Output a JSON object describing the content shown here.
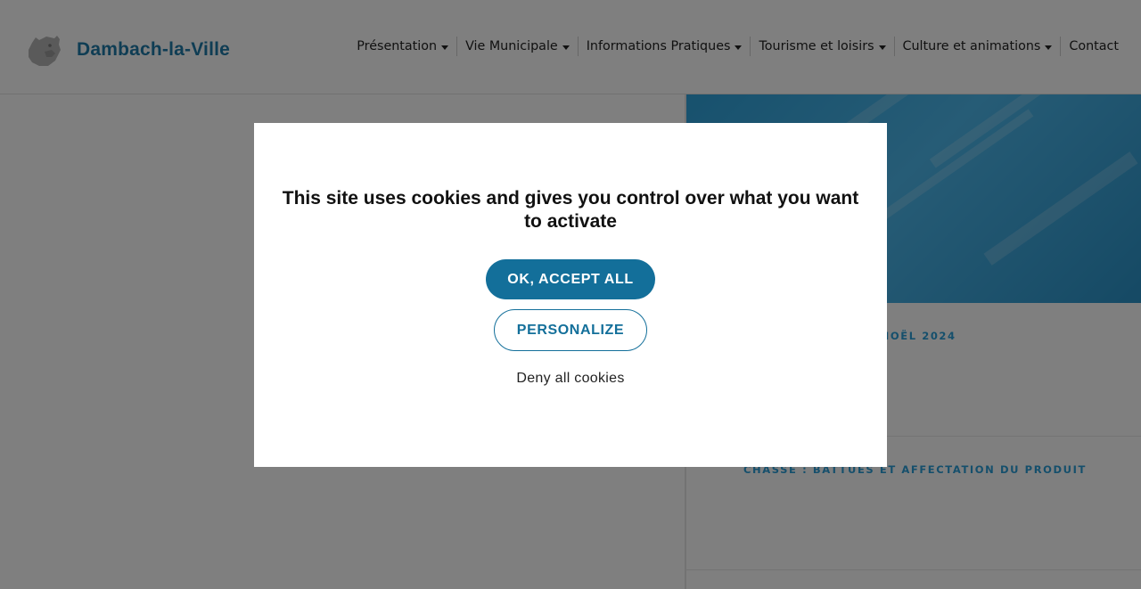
{
  "header": {
    "site_name": "Dambach-la-Ville",
    "logo_icon": "bear-head-logo",
    "nav": [
      {
        "label": "Présentation",
        "has_dropdown": true
      },
      {
        "label": "Vie Municipale",
        "has_dropdown": true
      },
      {
        "label": "Informations Pratiques",
        "has_dropdown": true
      },
      {
        "label": "Tourisme et loisirs",
        "has_dropdown": true
      },
      {
        "label": "Culture et animations",
        "has_dropdown": true
      },
      {
        "label": "Contact",
        "has_dropdown": false
      }
    ]
  },
  "news": {
    "items": [
      {
        "title": "Illuminations de Noël 2024"
      },
      {
        "title": "Chasse : battues et affectation du produit"
      }
    ]
  },
  "cookie_modal": {
    "title": "This site uses cookies and gives you control over what you want to activate",
    "accept_label": "OK, ACCEPT ALL",
    "personalize_label": "PERSONALIZE",
    "deny_label": "Deny all cookies"
  },
  "colors": {
    "brand_blue": "#1f7aa8",
    "button_blue": "#136f9a",
    "news_title_blue": "#2a9fd8",
    "overlay": "rgba(0,0,0,0.5)"
  }
}
